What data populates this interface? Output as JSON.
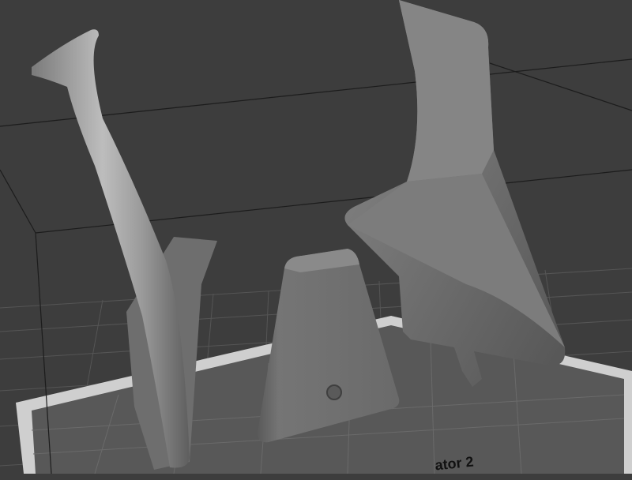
{
  "viewport": {
    "plate_label": "ator 2",
    "colors": {
      "background": "#3d3d3d",
      "grid_line": "#5a5a5a",
      "build_plate": "#cfcfcf",
      "plate_inner": "#585858",
      "volume_edge": "#1c1c1c",
      "model_shade": "#6b6b6b"
    },
    "objects": [
      {
        "name": "curved-arm-part"
      },
      {
        "name": "trapezoid-bracket-part"
      },
      {
        "name": "fin-wing-part"
      }
    ]
  }
}
